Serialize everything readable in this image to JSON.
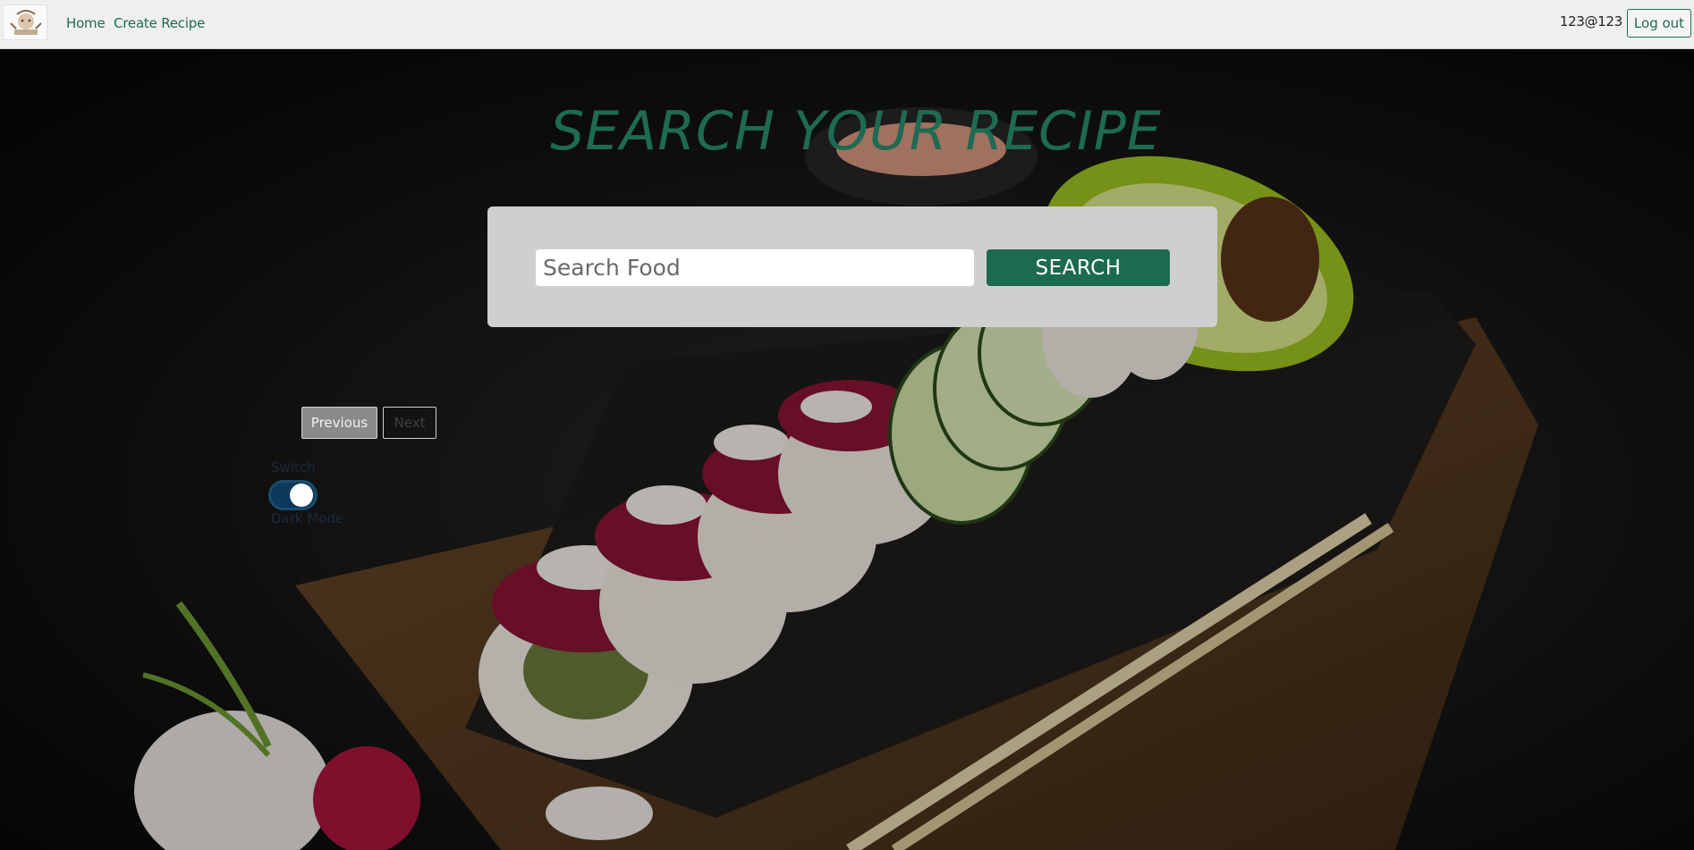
{
  "nav": {
    "home_label": "Home",
    "create_label": "Create Recipe",
    "user_email": "123@123",
    "logout_label": "Log out"
  },
  "hero": {
    "title": "SEARCH YOUR RECIPE"
  },
  "search": {
    "placeholder": "Search Food",
    "value": "",
    "button_label": "SEARCH"
  },
  "pagination": {
    "previous_label": "Previous",
    "next_label": "Next"
  },
  "theme_switch": {
    "label": "Switch",
    "caption": "Dark Mode",
    "on": true
  },
  "colors": {
    "brand": "#1c6a50",
    "nav_bg": "#efefef",
    "panel_bg": "#cfcfcf"
  }
}
